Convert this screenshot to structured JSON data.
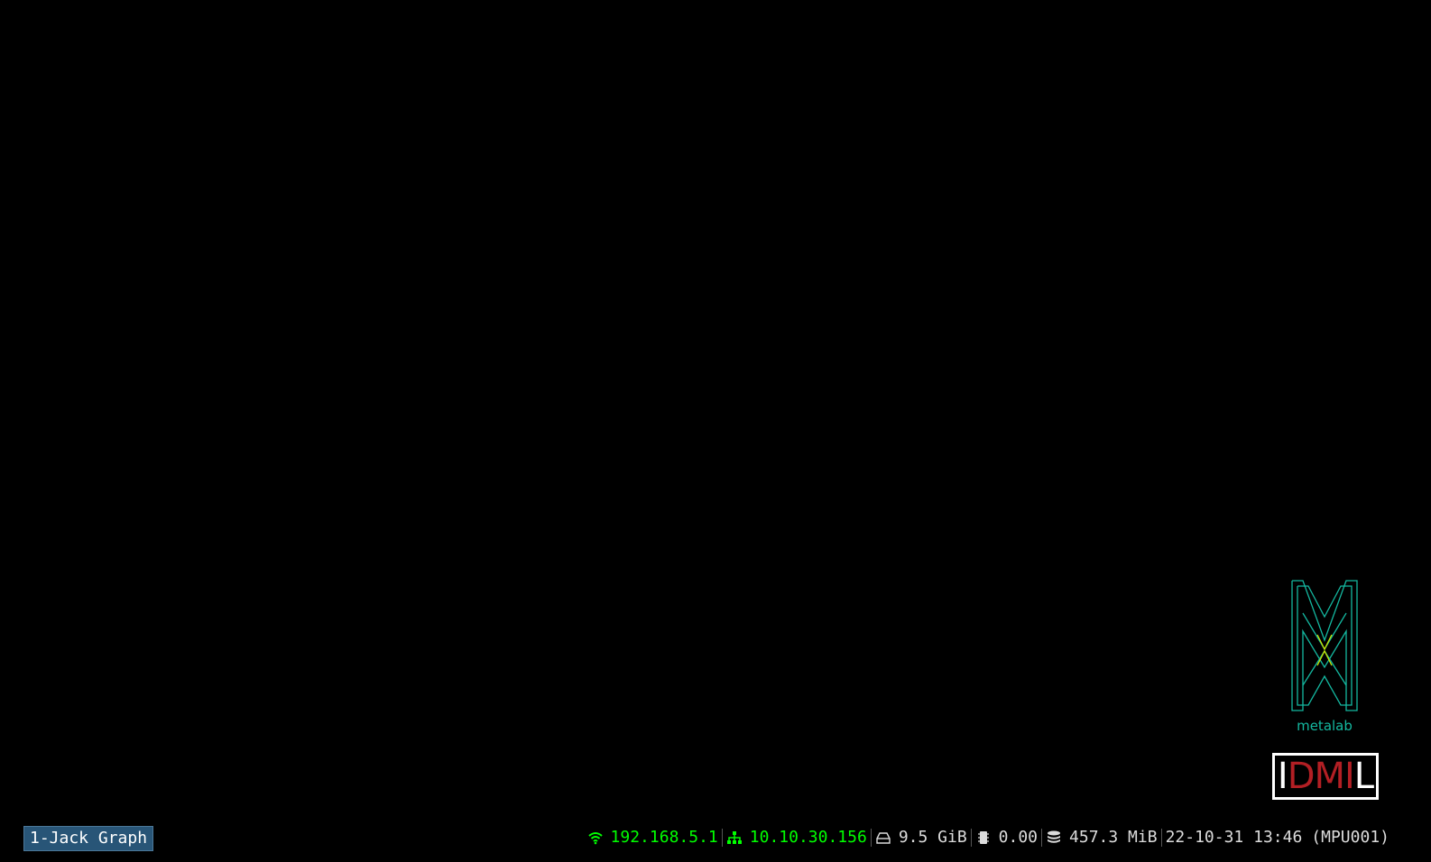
{
  "workspace": {
    "label": "1-Jack Graph"
  },
  "logos": {
    "metalab_text": "metalab",
    "idmil": {
      "letter_i": "I",
      "letters_dm": "DM",
      "letter_i2": "I",
      "letter_l": "L"
    }
  },
  "status": {
    "wireless": {
      "icon": "wifi-icon",
      "value": "192.168.5.1"
    },
    "ethernet": {
      "icon": "network-icon",
      "value": "10.10.30.156"
    },
    "disk": {
      "icon": "disk-icon",
      "value": "9.5 GiB"
    },
    "load": {
      "icon": "cpu-icon",
      "value": "0.00"
    },
    "memory": {
      "icon": "memory-icon",
      "value": "457.3 MiB"
    },
    "datetime": "22-10-31 13:46",
    "hostname": "(MPU001)"
  },
  "colors": {
    "background": "#000000",
    "workspace_bg": "#285577",
    "workspace_border": "#4c7899",
    "status_good": "#00ff00",
    "status_text": "#dcdcdc",
    "metalab_teal": "#14b8a0",
    "metalab_yellow": "#c8e600",
    "idmil_red": "#b21f24"
  }
}
